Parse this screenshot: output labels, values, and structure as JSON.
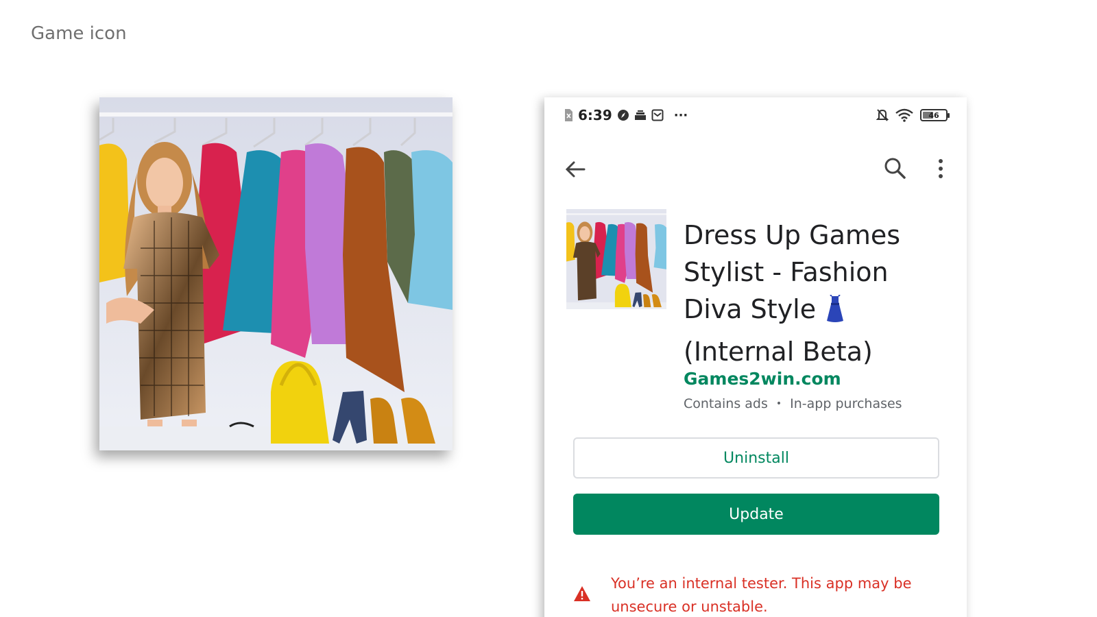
{
  "slide": {
    "title": "Game icon"
  },
  "status_bar": {
    "time": "6:39",
    "battery": "46",
    "more": "···",
    "icons": [
      "sim-off-icon",
      "compass-icon",
      "storage-icon",
      "mail-icon",
      "bell-off-icon",
      "wifi-icon",
      "battery-icon"
    ]
  },
  "toolbar": {
    "back_icon": "arrow-left-icon",
    "search_icon": "search-icon",
    "more_icon": "more-vertical-icon"
  },
  "app": {
    "title": "Dress Up Games Stylist - Fashion Diva Style",
    "title_suffix": "(Internal Beta)",
    "title_emoji_icon": "dress-icon",
    "developer": "Games2win.com",
    "meta": [
      "Contains ads",
      "In-app purchases"
    ],
    "meta_separator": "•"
  },
  "actions": {
    "uninstall_label": "Uninstall",
    "update_label": "Update"
  },
  "warning": {
    "icon": "warning-icon",
    "text": "You’re an internal tester. This app may be unsecure or unstable."
  },
  "colors": {
    "accent_green": "#01875f",
    "warning_red": "#d93025",
    "title_text": "#202124",
    "secondary_text": "#5f6368"
  }
}
